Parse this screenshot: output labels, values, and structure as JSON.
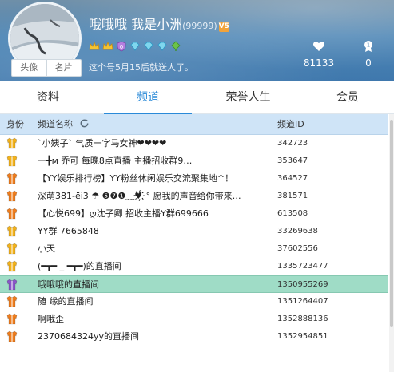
{
  "profile": {
    "name": "哦哦哦 我是小洲",
    "uid": "(99999)",
    "level_badge": "V5",
    "avatar_tabs": [
      "头像",
      "名片"
    ],
    "motto": "这个号5月15后就送人了。",
    "badges": [
      "crown-badge",
      "crown-badge",
      "shield-badge",
      "diamond-badge",
      "diamond-badge",
      "diamond-badge",
      "leaf-badge"
    ]
  },
  "stats": {
    "likes": {
      "icon": "heart-icon",
      "value": "81133"
    },
    "awards": {
      "icon": "medal-icon",
      "value": "0"
    }
  },
  "tabs": [
    "资料",
    "频道",
    "荣誉人生",
    "会员"
  ],
  "active_tab": "频道",
  "table": {
    "headers": {
      "role": "身份",
      "name": "频道名称",
      "id": "频道ID"
    },
    "rows": [
      {
        "role": "yellow-vest-icon",
        "name": "`小姨子` 气质一字马女神❤❤❤❤",
        "id": "342723"
      },
      {
        "role": "yellow-vest-icon",
        "name": "一╋м     乔可        每晚8点直播      主播招收群9…",
        "id": "353647"
      },
      {
        "role": "orange-vest-icon",
        "name": "【YY娱乐排行榜】YY粉丝休闲娱乐交流聚集地^！",
        "id": "364527"
      },
      {
        "role": "orange-vest-icon",
        "name": "深萌381-ёі3 ☂ ❺❼❶﹏♥҉° 愿我的声音给你带来…",
        "id": "381571"
      },
      {
        "role": "orange-vest-icon",
        "name": "【心悦699】ღ沈子卿 招收主播Y群699666",
        "id": "613508"
      },
      {
        "role": "yellow-vest-icon",
        "name": "YY群    7665848",
        "id": "33269638"
      },
      {
        "role": "yellow-vest-icon",
        "name": "小天",
        "id": "37602556"
      },
      {
        "role": "yellow-vest-icon",
        "name": "(━┳━ _ ━┳━)的直播间",
        "id": "1335723477"
      },
      {
        "role": "purple-vest-icon",
        "name": "哦哦哦的直播间",
        "id": "1350955269"
      },
      {
        "role": "orange-vest-icon",
        "name": "随    缘的直播间",
        "id": "1351264407"
      },
      {
        "role": "orange-vest-icon",
        "name": "啊哦歪",
        "id": "1352888136"
      },
      {
        "role": "orange-vest-icon",
        "name": "2370684324yy的直播间",
        "id": "1352954851"
      }
    ],
    "selected_row": 8
  },
  "colors": {
    "accent": "#2a8ad8",
    "header_bg": "#4f87b6",
    "table_header_bg": "#cfe4f7",
    "selected_row_bg": "#9fdcc6",
    "vest_yellow": "#f2b21c",
    "vest_orange": "#ee7d1e",
    "vest_purple": "#8a55c8"
  }
}
